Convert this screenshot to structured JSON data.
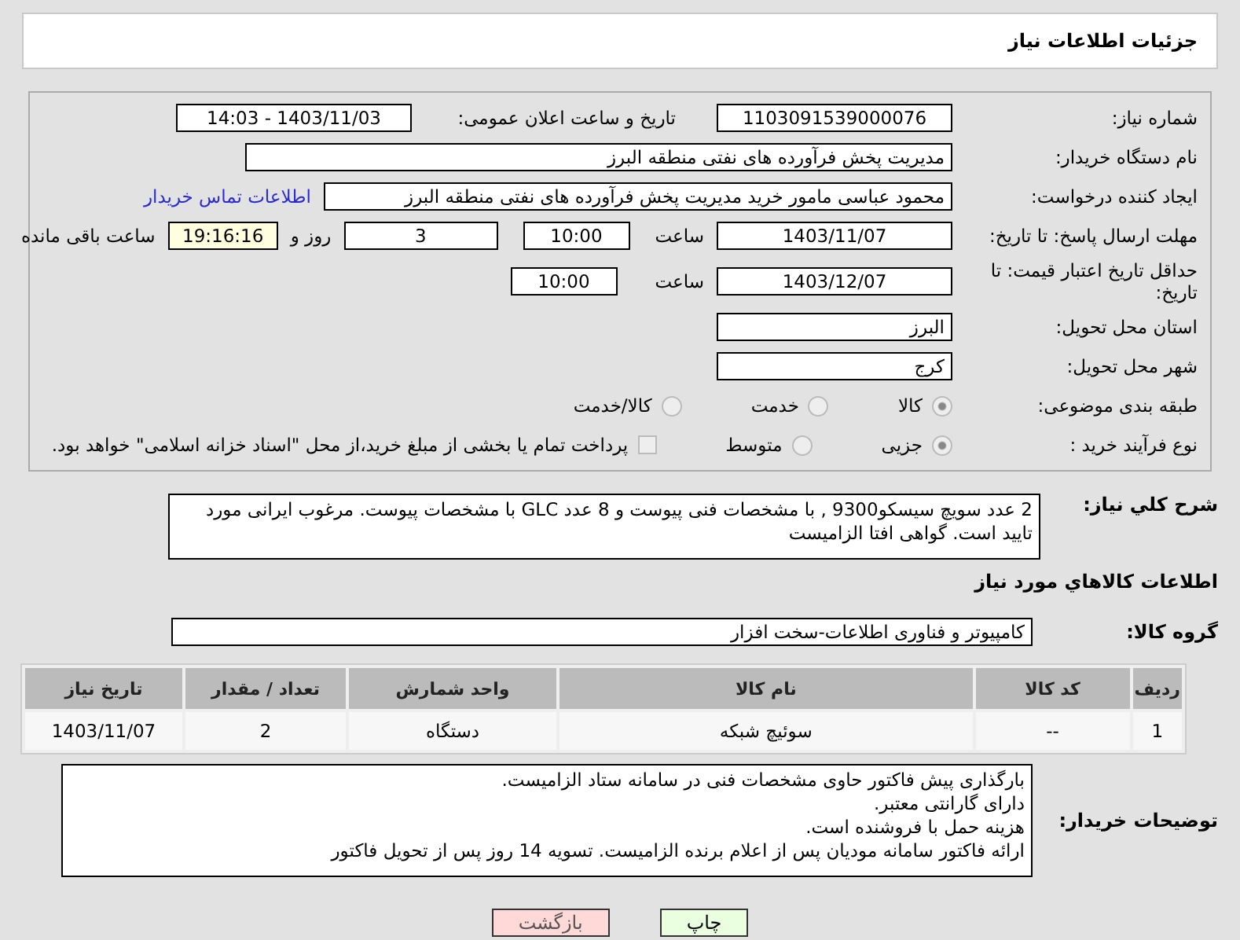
{
  "header": {
    "title": "جزئیات اطلاعات نیاز"
  },
  "form": {
    "need_number": {
      "label": "شماره نیاز:",
      "value": "1103091539000076"
    },
    "announce": {
      "label": "تاریخ و ساعت اعلان عمومی:",
      "value": "1403/11/03 - 14:03"
    },
    "buyer_org": {
      "label": "نام دستگاه خریدار:",
      "value": "مدیریت پخش فرآورده های نفتی منطقه البرز"
    },
    "creator": {
      "label": "ایجاد کننده درخواست:",
      "value": "محمود عباسی مامور خرید  مدیریت پخش فرآورده های نفتی منطقه البرز",
      "link": "اطلاعات تماس خریدار"
    },
    "deadline": {
      "label": "مهلت ارسال پاسخ: تا تاریخ:",
      "date": "1403/11/07",
      "time_label": "ساعت",
      "time": "10:00",
      "days": "3",
      "days_label": "روز و",
      "remaining": "19:16:16",
      "remaining_label": "ساعت باقی مانده"
    },
    "validity": {
      "label": "حداقل تاریخ اعتبار قیمت: تا تاریخ:",
      "date": "1403/12/07",
      "time_label": "ساعت",
      "time": "10:00"
    },
    "province": {
      "label": "استان محل تحویل:",
      "value": "البرز"
    },
    "city": {
      "label": "شهر محل تحویل:",
      "value": "کرج"
    },
    "category": {
      "label": "طبقه بندی موضوعی:",
      "options": [
        {
          "label": "کالا",
          "selected": true
        },
        {
          "label": "خدمت",
          "selected": false
        },
        {
          "label": "کالا/خدمت",
          "selected": false
        }
      ]
    },
    "process": {
      "label": "نوع فرآیند خرید :",
      "options": [
        {
          "label": "جزیی",
          "selected": true
        },
        {
          "label": "متوسط",
          "selected": false
        }
      ],
      "treasury": {
        "label": "پرداخت تمام یا بخشی از مبلغ خرید،از محل \"اسناد خزانه اسلامی\" خواهد بود.",
        "checked": false
      }
    }
  },
  "description": {
    "label": "شرح کلي نياز:",
    "value": "2 عدد سویچ سیسکو9300 ,  با مشخصات فنی پیوست و 8 عدد GLC با مشخصات پیوست.  مرغوب ایرانی مورد تایید است. گواهی افتا الزامیست"
  },
  "goods": {
    "heading": "اطلاعات کالاهاي مورد نياز",
    "group_label": "گروه کالا:",
    "group": "کامپیوتر و فناوری اطلاعات-سخت افزار",
    "table": {
      "columns": [
        "ردیف",
        "کد کالا",
        "نام کالا",
        "واحد شمارش",
        "تعداد / مقدار",
        "تاریخ نیاز"
      ],
      "rows": [
        [
          "1",
          "--",
          "سوئیچ شبکه",
          "دستگاه",
          "2",
          "1403/11/07"
        ]
      ]
    }
  },
  "notes": {
    "label": "توضیحات خریدار:",
    "lines": [
      "بارگذاری پیش فاکتور حاوی مشخصات فنی در سامانه ستاد الزامیست.",
      "دارای گارانتی معتبر.",
      "هزینه حمل با فروشنده است.",
      "ارائه فاکتور سامانه مودیان پس از اعلام برنده الزامیست. تسویه 14 روز پس از تحویل فاکتور"
    ]
  },
  "buttons": [
    {
      "label": "چاپ",
      "kind": "print"
    },
    {
      "label": "بازگشت",
      "kind": "back"
    }
  ]
}
